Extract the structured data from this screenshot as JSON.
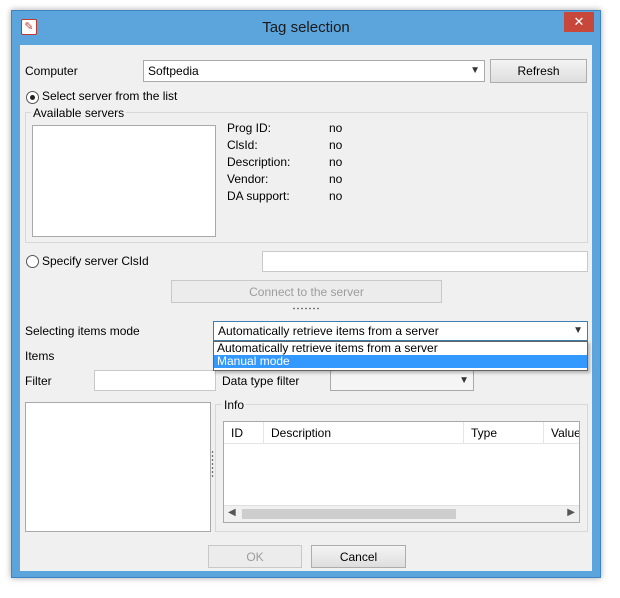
{
  "window": {
    "title": "Tag selection",
    "close_glyph": "✕"
  },
  "computer": {
    "label": "Computer",
    "value": "Softpedia",
    "refresh_label": "Refresh"
  },
  "server_mode": {
    "select_from_list_label": "Select server from the list",
    "specify_clsid_label": "Specify server ClsId",
    "specify_clsid_value": ""
  },
  "available_servers": {
    "group_label": "Available servers",
    "properties": [
      {
        "name": "Prog ID:",
        "value": "no"
      },
      {
        "name": "ClsId:",
        "value": "no"
      },
      {
        "name": "Description:",
        "value": "no"
      },
      {
        "name": "Vendor:",
        "value": "no"
      },
      {
        "name": "DA support:",
        "value": "no"
      }
    ]
  },
  "connect_label": "Connect to the server",
  "selecting_mode": {
    "label": "Selecting items mode",
    "value": "Automatically retrieve items from a server",
    "options": [
      "Automatically retrieve items from a server",
      "Manual mode"
    ],
    "selected_option": "Manual mode"
  },
  "items_label": "Items",
  "filter": {
    "label": "Filter",
    "value": ""
  },
  "data_type_filter": {
    "label": "Data type filter",
    "value": ""
  },
  "info": {
    "group_label": "Info",
    "columns": [
      "ID",
      "Description",
      "Type",
      "Value"
    ]
  },
  "footer": {
    "ok_label": "OK",
    "cancel_label": "Cancel"
  },
  "icons": {
    "window_icon": "app-icon",
    "close": "close-icon",
    "dropdown": "chevron-down-icon"
  },
  "colors": {
    "titlebar": "#5ba4dc",
    "close_button": "#c7473a",
    "selection": "#3399ff"
  }
}
